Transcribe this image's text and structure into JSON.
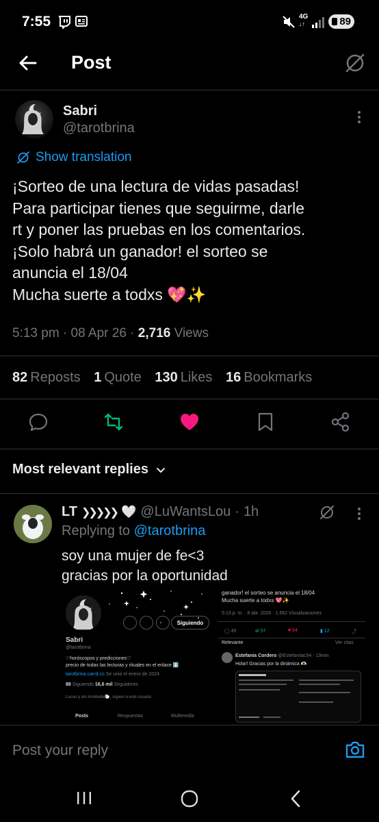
{
  "status_bar": {
    "time": "7:55",
    "battery": "89",
    "network": "4G"
  },
  "header": {
    "title": "Post"
  },
  "post": {
    "author_name": "Sabri",
    "author_handle": "@tarotbrina",
    "show_translation": "Show translation",
    "lines": [
      "¡Sorteo de una lectura de vidas pasadas!",
      "Para participar tienes que seguirme, darle",
      "rt y poner las pruebas en los comentarios.",
      "¡Solo habrá un ganador! el sorteo se",
      "anuncia el 18/04",
      "Mucha suerte a todxs 💖✨"
    ],
    "time": "5:13 pm",
    "date": "08 Apr 26",
    "views_count": "2,716",
    "views_label": "Views",
    "stats": [
      {
        "count": "82",
        "label": "Reposts"
      },
      {
        "count": "1",
        "label": "Quote"
      },
      {
        "count": "130",
        "label": "Likes"
      },
      {
        "count": "16",
        "label": "Bookmarks"
      }
    ]
  },
  "replies_sort": {
    "label": "Most relevant replies"
  },
  "reply": {
    "author_name": "LT",
    "author_handle": "@LuWantsLou",
    "time": "1h",
    "replying_to_label": "Replying to",
    "replying_to_handle": "@tarotbrina",
    "text_line1": "soy una mujer de fe<3",
    "text_line2": "gracias por la oportunidad",
    "embedded_left": {
      "follow_button": "Siguiendo",
      "name": "Sabri",
      "handle": "@tarotbrina",
      "bio_line1": "♡horóscopos y predicciones♡",
      "bio_line2": "precio de todas las lecturas y rituales en el enlace ⬇️",
      "link": "tarotbrina.carrd.co",
      "joined": "Se unió el enero de 2024",
      "following_count": "88",
      "following_label": "Siguiendo",
      "followers_count": "16,6 mil",
      "followers_label": "Seguidores",
      "followed_by": "Lucoo y ani monbebe🐑, siguen a este usuario",
      "tabs": [
        "Posts",
        "Respuestas",
        "Multimedia"
      ]
    },
    "embedded_right": {
      "line1": "ganador! el sorteo se anuncia el 18/04",
      "line2": "Mucha suerte a todxs 💖✨",
      "meta": "5:13 p. m. · 8 abr. 2026 · 1.662 Visualizaciones",
      "action_counts": [
        "45",
        "57",
        "64",
        "12"
      ],
      "relevant": "Relevante",
      "see_quotes": "Ver citas",
      "reply_name": "Estefania Cordero",
      "reply_handle": "@Estefaniiac94 · 19min",
      "reply_text": "Hola!! Gracias por la dinámica 🫶🏻"
    }
  },
  "composer": {
    "placeholder": "Post your reply"
  },
  "colors": {
    "accent": "#1d9bf0",
    "like": "#f91880",
    "repost": "#00ba7c",
    "muted": "#71767b"
  }
}
